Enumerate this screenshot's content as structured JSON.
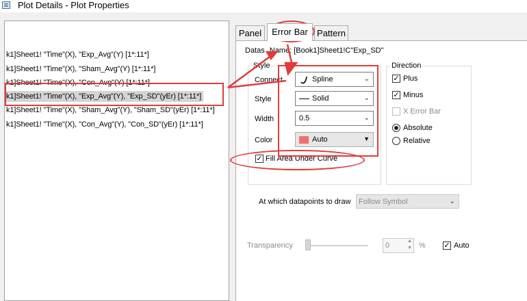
{
  "window": {
    "title": "Plot Details - Plot Properties"
  },
  "tree": {
    "items": [
      {
        "label": "k1]Sheet1! \"Time\"(X), \"Exp_Avg\"(Y) [1*:11*]",
        "selected": false
      },
      {
        "label": "k1]Sheet1! \"Time\"(X), \"Sham_Avg\"(Y) [1*:11*]",
        "selected": false
      },
      {
        "label": "k1]Sheet1! \"Time\"(X), \"Con_Avg\"(Y) [1*:11*]",
        "selected": false
      },
      {
        "label": "k1]Sheet1! \"Time\"(X), \"Exp_Avg\"(Y), \"Exp_SD\"(yEr) [1*:11*]",
        "selected": true
      },
      {
        "label": "k1]Sheet1! \"Time\"(X), \"Sham_Avg\"(Y), \"Sham_SD\"(yEr) [1*:11*]",
        "selected": false
      },
      {
        "label": "k1]Sheet1! \"Time\"(X), \"Con_Avg\"(Y), \"Con_SD\"(yEr) [1*:11*]",
        "selected": false
      }
    ]
  },
  "tabs": [
    {
      "label": "Panel",
      "active": false
    },
    {
      "label": "Error Bar",
      "active": true
    },
    {
      "label": "Pattern",
      "active": false
    }
  ],
  "dataset": {
    "label": "Datas",
    "name": "Name: [Book1]Sheet1!C\"Exp_SD\""
  },
  "style_group": {
    "legend": "Style",
    "connect": {
      "label": "Connect",
      "value": "Spline"
    },
    "style": {
      "label": "Style",
      "value": "Solid"
    },
    "width": {
      "label": "Width",
      "value": "0.5"
    },
    "color": {
      "label": "Color",
      "value": "Auto",
      "swatch": "#f07070"
    },
    "fill_area": {
      "label": "Fill Area Under Curve",
      "checked": true
    }
  },
  "direction_group": {
    "legend": "Direction",
    "plus": {
      "label": "Plus",
      "checked": true
    },
    "minus": {
      "label": "Minus",
      "checked": true
    },
    "x_error_bar": {
      "label": "X Error Bar",
      "checked": false,
      "disabled": true
    },
    "absolute": {
      "label": "Absolute",
      "selected": true
    },
    "relative": {
      "label": "Relative",
      "selected": false
    }
  },
  "draw_at": {
    "label": "At which datapoints to draw",
    "value": "Follow Symbol"
  },
  "transparency": {
    "label": "Transparency",
    "value": "0",
    "unit": "%",
    "auto_label": "Auto",
    "auto_checked": true
  },
  "colors": {
    "annotation": "#e23a3a",
    "selection": "#d4d4d4"
  }
}
